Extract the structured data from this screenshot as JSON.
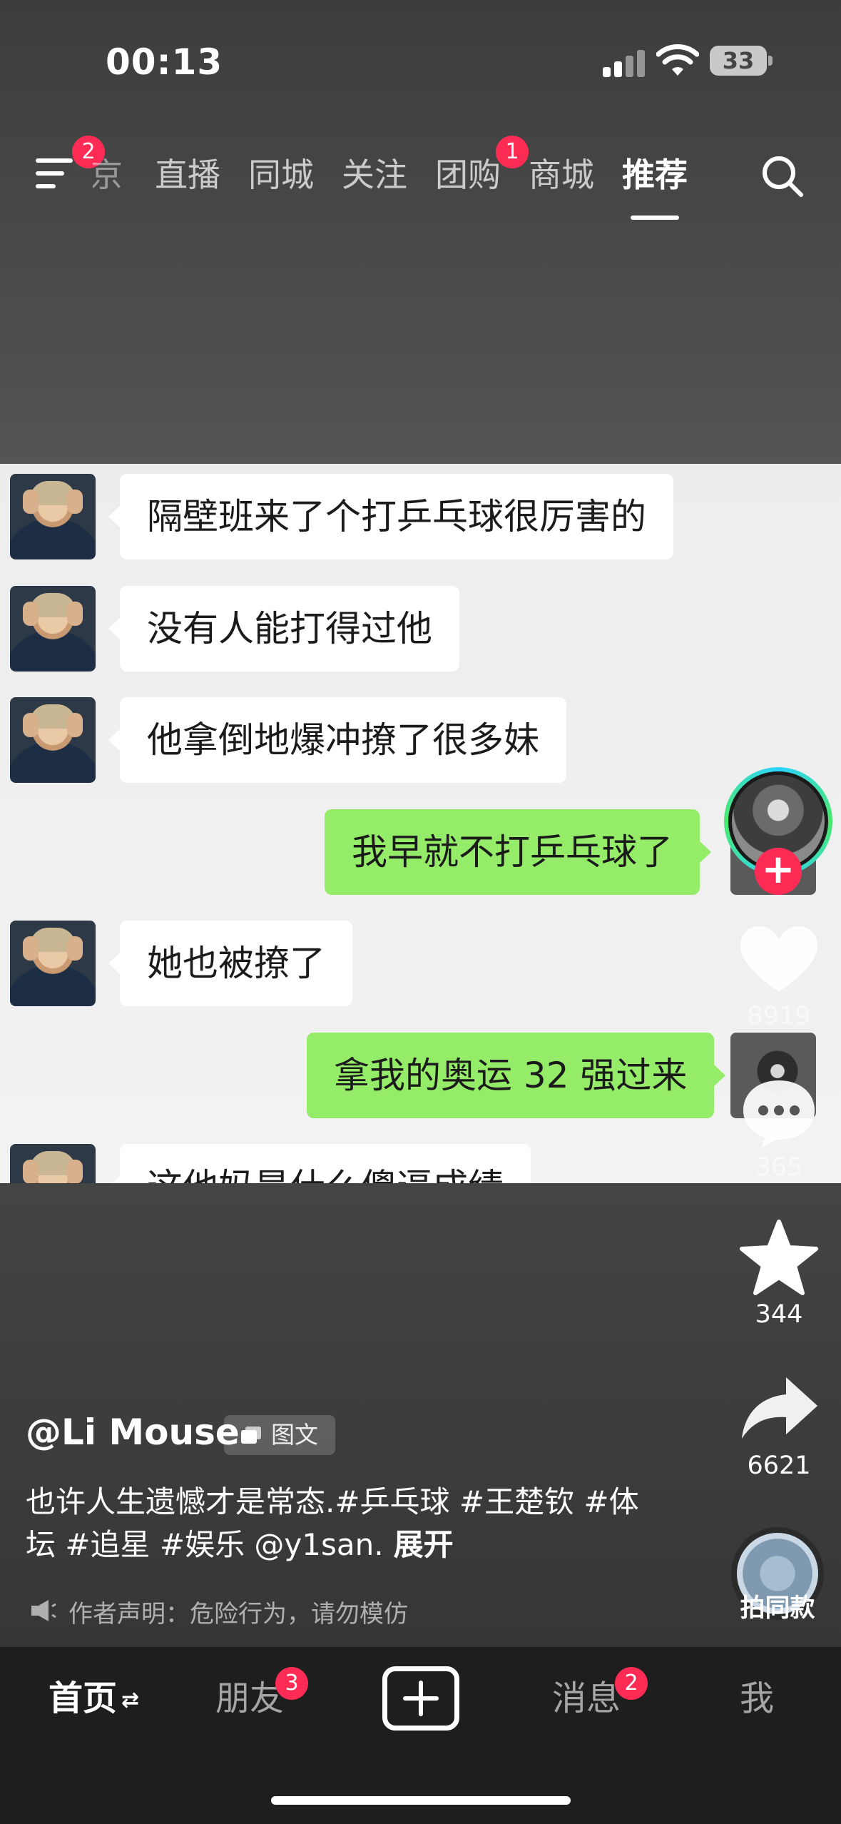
{
  "status_bar": {
    "time": "00:13",
    "battery": "33"
  },
  "top_nav": {
    "menu_badge": "2",
    "tabs": [
      {
        "label": "京"
      },
      {
        "label": "直播"
      },
      {
        "label": "同城"
      },
      {
        "label": "关注"
      },
      {
        "label": "团购",
        "badge": "1"
      },
      {
        "label": "商城"
      },
      {
        "label": "推荐"
      }
    ],
    "active_tab": "推荐"
  },
  "chat": {
    "messages": [
      {
        "side": "left",
        "text": "隔壁班来了个打乒乓球很厉害的"
      },
      {
        "side": "left",
        "text": "没有人能打得过他"
      },
      {
        "side": "left",
        "text": "他拿倒地爆冲撩了很多妹"
      },
      {
        "side": "right",
        "text": "我早就不打乒乓球了"
      },
      {
        "side": "left",
        "text": "她也被撩了"
      },
      {
        "side": "right",
        "text": "拿我的奥运 32 强过来"
      },
      {
        "side": "left",
        "text": "这他妈是什么傻逼成绩"
      }
    ],
    "colors": {
      "left_bubble": "#ffffff",
      "right_bubble": "#95ec69"
    }
  },
  "actions": {
    "follow": "+",
    "likes": "8919",
    "comments": "365",
    "favorites": "344",
    "shares": "6621",
    "music_label": "拍同款"
  },
  "post": {
    "author": "@Li Mouse",
    "type_tag": "图文",
    "caption": "也许人生遗憾才是常态.#乒乓球 #王楚钦 #体坛 #追星 #娱乐 @y1san.",
    "expand": "展开",
    "declaration": "作者声明：危险行为，请勿模仿"
  },
  "bottom_nav": {
    "home": "首页",
    "friends": "朋友",
    "friends_badge": "3",
    "messages": "消息",
    "messages_badge": "2",
    "me": "我"
  },
  "colors": {
    "badge": "#fe2c55",
    "accent_ring": "#2bd4ff"
  }
}
